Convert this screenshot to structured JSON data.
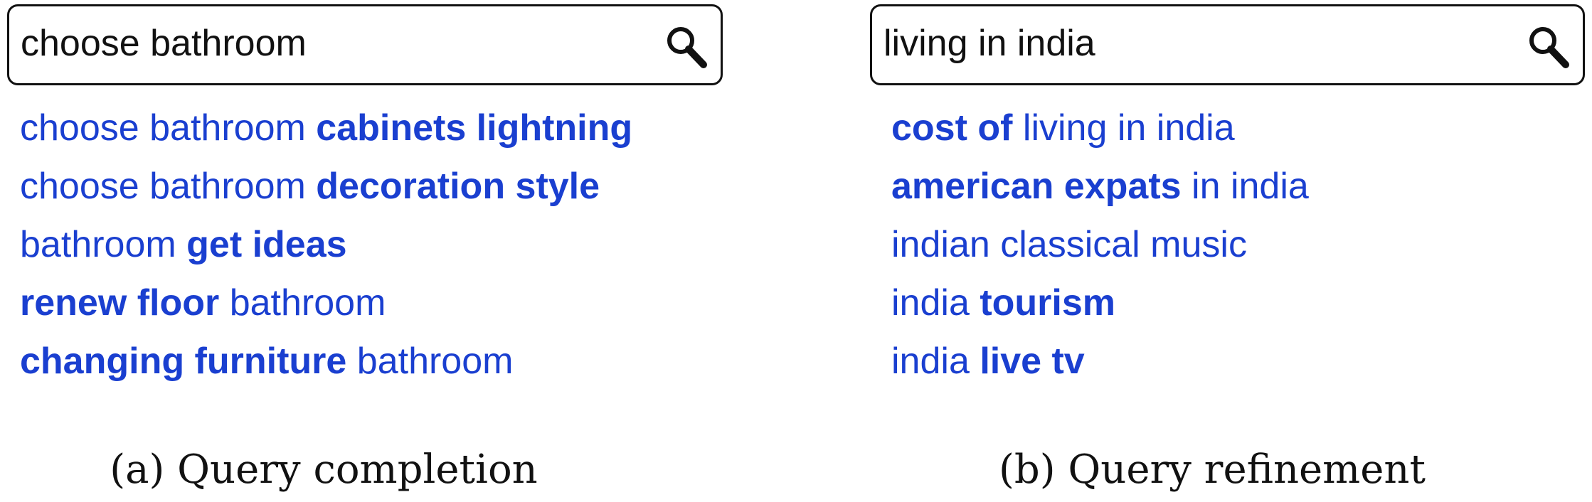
{
  "panels": [
    {
      "query": "choose bathroom",
      "suggestions": [
        [
          {
            "t": "choose bathroom ",
            "b": false
          },
          {
            "t": "cabinets lightning",
            "b": true
          }
        ],
        [
          {
            "t": "choose bathroom ",
            "b": false
          },
          {
            "t": "decoration style",
            "b": true
          }
        ],
        [
          {
            "t": "bathroom ",
            "b": false
          },
          {
            "t": "get ideas",
            "b": true
          }
        ],
        [
          {
            "t": "renew floor",
            "b": true
          },
          {
            "t": " bathroom",
            "b": false
          }
        ],
        [
          {
            "t": "changing furniture",
            "b": true
          },
          {
            "t": " bathroom",
            "b": false
          }
        ]
      ],
      "caption": "(a) Query completion"
    },
    {
      "query": "living in india",
      "suggestions": [
        [
          {
            "t": "cost of",
            "b": true
          },
          {
            "t": " living in india",
            "b": false
          }
        ],
        [
          {
            "t": "american expats",
            "b": true
          },
          {
            "t": " in india",
            "b": false
          }
        ],
        [
          {
            "t": "indian classical music",
            "b": false
          }
        ],
        [
          {
            "t": "india ",
            "b": false
          },
          {
            "t": "tourism",
            "b": true
          }
        ],
        [
          {
            "t": "india ",
            "b": false
          },
          {
            "t": "live tv",
            "b": true
          }
        ]
      ],
      "caption": "(b) Query refinement"
    }
  ],
  "colors": {
    "link": "#1a3fd0",
    "border": "#111111"
  },
  "icons": {
    "search": "search-icon"
  }
}
